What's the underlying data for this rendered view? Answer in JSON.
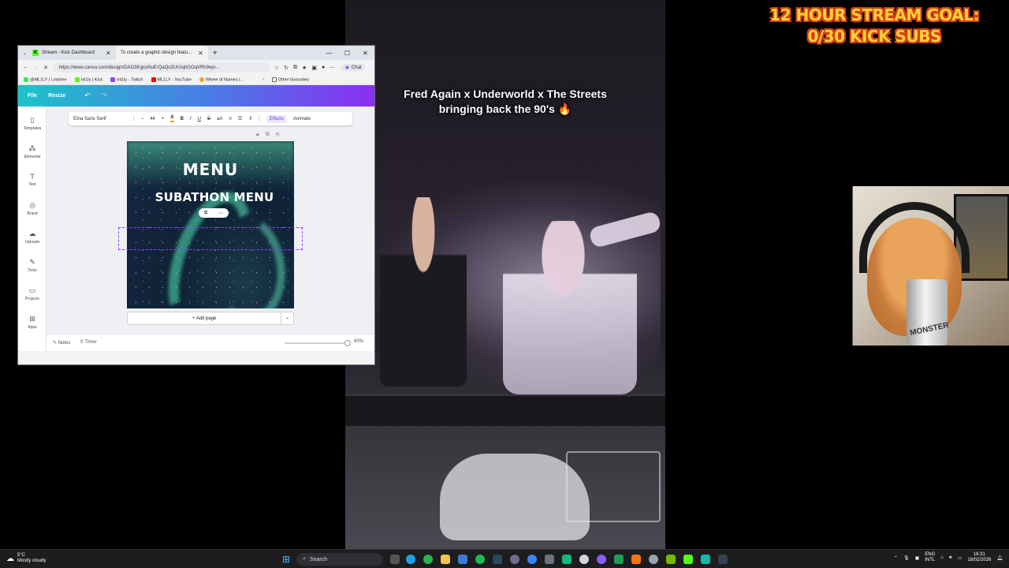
{
  "stream_goal": {
    "line1": "12 HOUR STREAM GOAL:",
    "line2": "0/30 KICK SUBS"
  },
  "video": {
    "caption_line1": "Fred Again x Underworld x The Streets",
    "caption_line2": "bringing back the 90's 🔥"
  },
  "webcam": {
    "can_text": "MONSTER"
  },
  "browser": {
    "tabs": [
      {
        "label": "Stream - Kick Dashboard",
        "active": false
      },
      {
        "label": "To create a graphic design featu...",
        "active": true
      }
    ],
    "new_tab": "+",
    "window_controls": {
      "minimize": "—",
      "maximize": "☐",
      "close": "✕"
    },
    "url": "https://www.canva.com/design/DAG3KgcuNuE/QaQo2UrUqhGOqVRh9wjx...",
    "chat_label": "Chat",
    "bookmarks": [
      {
        "label": "@ML1LY | Linktree",
        "color": "#43e55e"
      },
      {
        "label": "ml1ly | Kick",
        "color": "#53fc18"
      },
      {
        "label": "ml1ly - Twitch",
        "color": "#9146ff"
      },
      {
        "label": "ML1LY - YouTube",
        "color": "#ff0000"
      },
      {
        "label": "Wheel of Names |...",
        "color": "#f6a623"
      }
    ],
    "other_favourites": "Other favourites"
  },
  "canva": {
    "top": {
      "file": "File",
      "resize": "Resize",
      "undo": "↶",
      "redo": "↷"
    },
    "sidebar": [
      {
        "label": "Templates",
        "icon": "▯"
      },
      {
        "label": "Elements",
        "icon": "⁂"
      },
      {
        "label": "Text",
        "icon": "T"
      },
      {
        "label": "Brand",
        "icon": "◎"
      },
      {
        "label": "Uploads",
        "icon": "☁"
      },
      {
        "label": "Tools",
        "icon": "✎"
      },
      {
        "label": "Projects",
        "icon": "▭"
      },
      {
        "label": "Apps",
        "icon": "⊞"
      }
    ],
    "toolbar": {
      "font": "Etna Sans Serif",
      "minus": "−",
      "size": "44",
      "plus": "+",
      "text_color": "A",
      "bold": "B",
      "italic": "I",
      "underline": "U",
      "strike": "S",
      "case": "aA",
      "effects": "Effects",
      "animate": "Animate"
    },
    "design": {
      "title": "MENU",
      "subtitle": "SUBATHON MENU"
    },
    "add_page": "+ Add page",
    "footer": {
      "notes": "Notes",
      "timer": "Timer",
      "zoom": "80%"
    }
  },
  "taskbar": {
    "weather_temp": "5°C",
    "weather_desc": "Mostly cloudy",
    "search_label": "Search",
    "lang_line1": "ENG",
    "lang_line2": "INTL",
    "time": "16:31",
    "date": "18/02/2026"
  }
}
